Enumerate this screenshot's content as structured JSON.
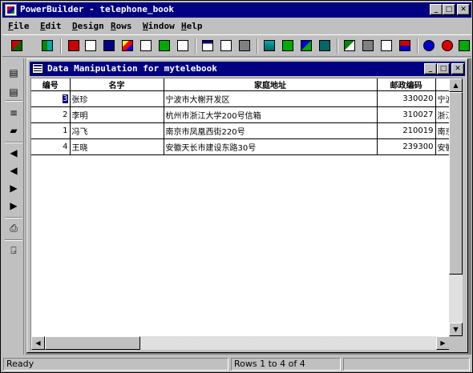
{
  "app": {
    "title": "PowerBuilder - telephone_book"
  },
  "window_controls": [
    "_",
    "□",
    "✕"
  ],
  "menu": [
    {
      "key": "F",
      "rest": "ile"
    },
    {
      "key": "E",
      "rest": "dit"
    },
    {
      "key": "D",
      "rest": "esign"
    },
    {
      "key": "R",
      "rest": "ows"
    },
    {
      "key": "W",
      "rest": "indow"
    },
    {
      "key": "H",
      "rest": "elp"
    }
  ],
  "toolbar_icons": [
    "application-icon",
    "library-icon",
    "datawindow-icon",
    "structure-icon",
    "menu-icon",
    "function-icon",
    "query-icon",
    "pipeline-icon",
    "user-object-icon",
    "window-icon",
    "project-icon",
    "database-icon",
    "database-profile-icon",
    "report-icon",
    "preview-icon",
    "run-icon",
    "debug-icon",
    "browser-icon",
    "help-icon",
    "exit-icon",
    "stop-icon",
    "toolbar-icon"
  ],
  "sidebar_icons": [
    "retrieve-icon",
    "update-icon",
    "insert-row-icon",
    "delete-row-icon",
    "first-page-icon",
    "prior-page-icon",
    "next-page-icon",
    "last-page-icon",
    "print-icon",
    "close-icon"
  ],
  "child": {
    "title": "Data Manipulation for mytelebook"
  },
  "table": {
    "columns": [
      "编号",
      "名字",
      "家庭地址",
      "邮政编码",
      ""
    ],
    "rows": [
      [
        "3",
        "张珍",
        "宁波市大榭开发区",
        "330020",
        "宁波"
      ],
      [
        "2",
        "李明",
        "杭州市浙江大学200号信箱",
        "310027",
        "浙江"
      ],
      [
        "1",
        "冯飞",
        "南京市凤凰西街220号",
        "210019",
        "南京"
      ],
      [
        "4",
        "王晓",
        "安徽天长市建设东路30号",
        "239300",
        "安徽"
      ]
    ]
  },
  "status": {
    "left": "Ready",
    "rows": "Rows 1 to 4 of 4"
  }
}
